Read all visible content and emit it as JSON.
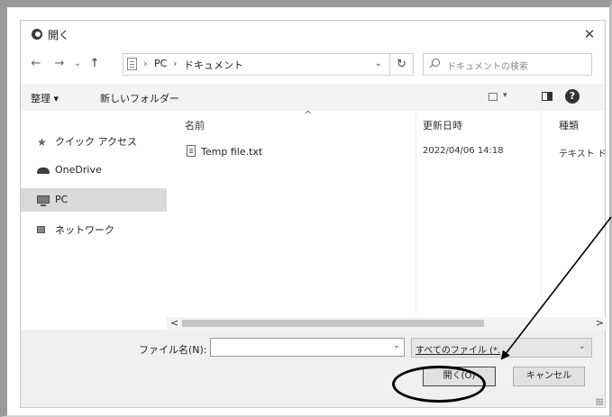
{
  "window": {
    "title": "開く"
  },
  "nav": {
    "back": "←",
    "forward": "→",
    "recent": "⌄",
    "up": "↑",
    "breadcrumb": [
      "PC",
      "ドキュメント"
    ],
    "separator": "›",
    "address_dropdown": "⌄",
    "refresh": "↻"
  },
  "search": {
    "placeholder": "ドキュメントの検索"
  },
  "toolbar": {
    "organize": "整理 ▾",
    "new_folder": "新しいフォルダー",
    "view_dropdown": "▾",
    "help": "?"
  },
  "sidebar": {
    "items": [
      {
        "label": "クイック アクセス",
        "icon": "star-icon"
      },
      {
        "label": "OneDrive",
        "icon": "cloud-icon"
      },
      {
        "label": "PC",
        "icon": "computer-icon",
        "selected": true
      },
      {
        "label": "ネットワーク",
        "icon": "network-icon"
      }
    ]
  },
  "filelist": {
    "sort_indicator": "^",
    "columns": [
      "名前",
      "更新日時",
      "種類"
    ],
    "rows": [
      {
        "name": "Temp file.txt",
        "modified": "2022/04/06 14:18",
        "type": "テキスト ド"
      }
    ]
  },
  "scrollbar": {
    "left": "<",
    "right": ">"
  },
  "footer": {
    "filename_label": "ファイル名(N):",
    "filename_value": "",
    "filename_dropdown": "⌄",
    "filetype_value": "すべてのファイル (*.",
    "filetype_dropdown": "⌄",
    "open_button": "開く(O)",
    "cancel_button": "キャンセル"
  },
  "close_glyph": "✕"
}
